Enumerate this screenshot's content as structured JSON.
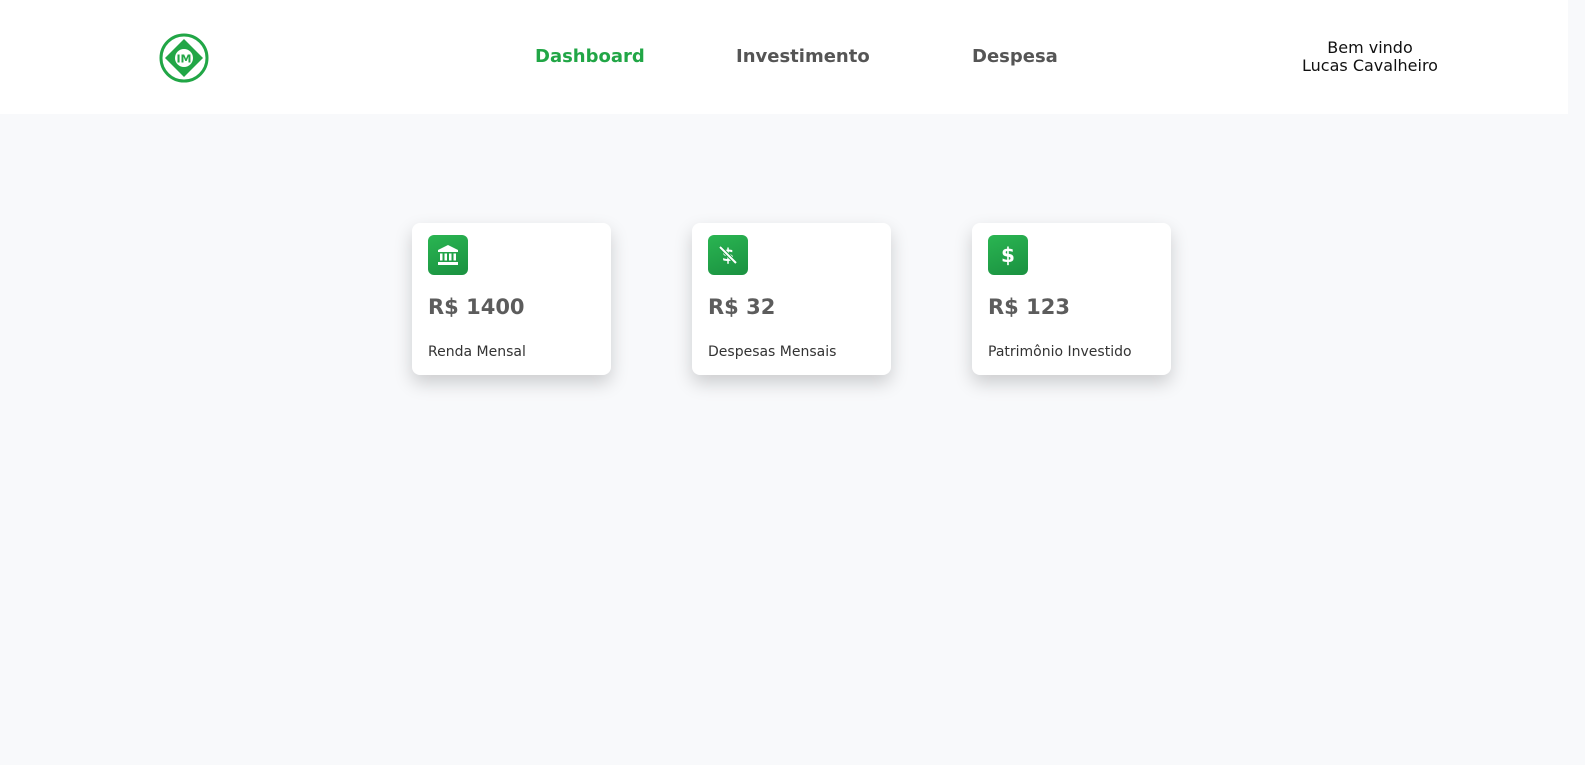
{
  "brand": {
    "logo_icon": "im-logo-icon",
    "logo_letters": "IM",
    "accent": "#21a646"
  },
  "nav": {
    "items": [
      {
        "label": "Dashboard",
        "active": true
      },
      {
        "label": "Investimento",
        "active": false
      },
      {
        "label": "Despesa",
        "active": false
      }
    ]
  },
  "user": {
    "greeting": "Bem vindo",
    "name": "Lucas Cavalheiro"
  },
  "cards": [
    {
      "icon": "bank-icon",
      "value": "R$ 1400",
      "label": "Renda Mensal"
    },
    {
      "icon": "no-dollar-icon",
      "value": "R$ 32",
      "label": "Despesas Mensais"
    },
    {
      "icon": "dollar-icon",
      "value": "R$ 123",
      "label": "Patrimônio Investido"
    }
  ]
}
